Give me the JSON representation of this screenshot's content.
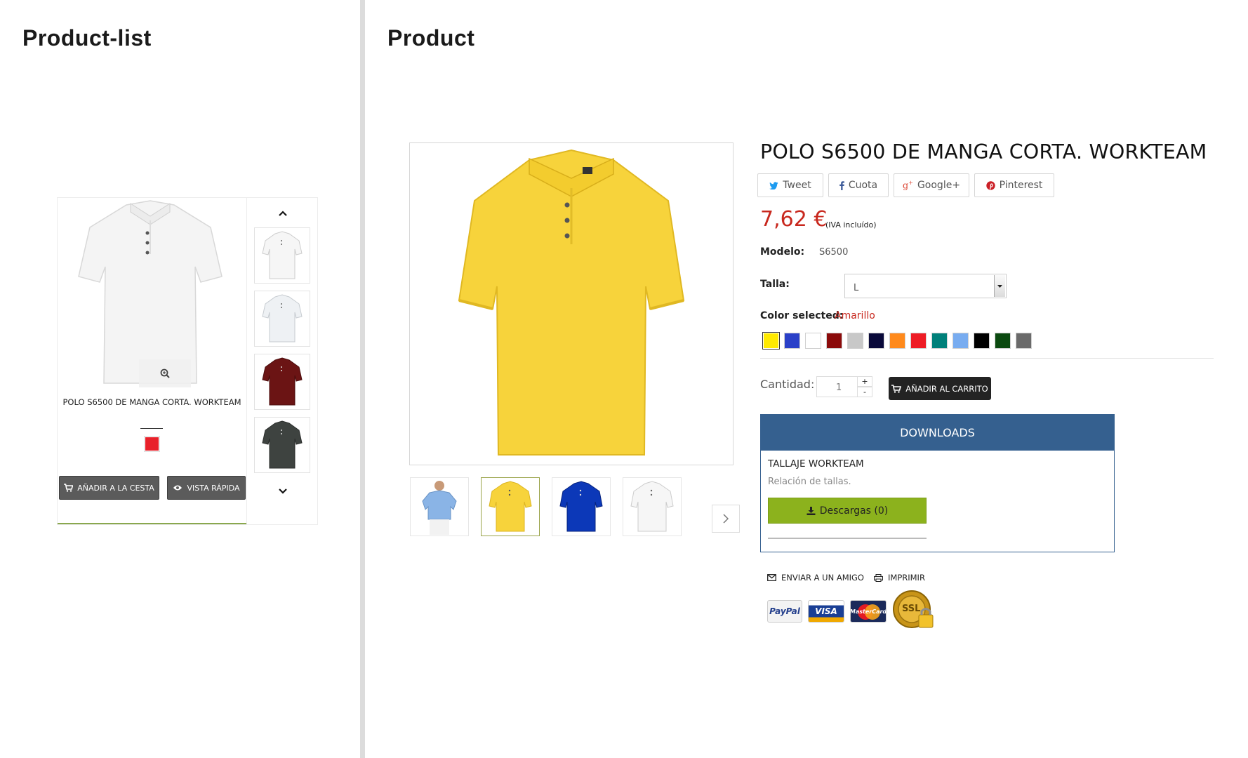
{
  "left_section": {
    "title": "Product-list"
  },
  "right_section": {
    "title": "Product"
  },
  "product_list": {
    "card": {
      "name": "POLO S6500 DE MANGA CORTA. WORKTEAM",
      "swatch_color": "#e8212a",
      "add_to_basket_label": "AÑADIR A LA CESTA",
      "quick_view_label": "VISTA RÁPIDA",
      "thumbnails": [
        "white-polo",
        "white-polo-back",
        "maroon-polo",
        "dark-grey-polo"
      ],
      "icons": [
        "zoom-icon",
        "chevron-up-icon",
        "chevron-down-icon",
        "cart-icon",
        "eye-icon"
      ]
    }
  },
  "product": {
    "title": "POLO S6500 DE MANGA CORTA. WORKTEAM",
    "share_buttons": [
      {
        "label": "Tweet",
        "icon": "twitter-icon"
      },
      {
        "label": "Cuota",
        "icon": "facebook-icon"
      },
      {
        "label": "Google+",
        "icon": "google-plus-icon"
      },
      {
        "label": "Pinterest",
        "icon": "pinterest-icon"
      }
    ],
    "price": "7,62 €",
    "price_note": "(IVA incluído)",
    "model_label": "Modelo:",
    "model_value": "S6500",
    "size_label": "Talla:",
    "size_value": "L",
    "color_label": "Color selected:",
    "color_value": "Amarillo",
    "colors": [
      "#ffea00",
      "#2a40c8",
      "#ffffff",
      "#8b0a0a",
      "#c8c8c8",
      "#0a0a3a",
      "#ff8a1c",
      "#ee1c25",
      "#00807a",
      "#78acf0",
      "#000000",
      "#0b4a10",
      "#6a6a6a"
    ],
    "selected_color_index": 0,
    "quantity_label": "Cantidad:",
    "quantity_value": "1",
    "quantity_plus": "+",
    "quantity_minus": "-",
    "add_to_cart_label": "AÑADIR AL CARRITO",
    "thumbnails": [
      "light-blue-polo-model",
      "yellow-polo",
      "royal-blue-polo",
      "white-polo"
    ],
    "active_thumbnail_index": 1,
    "downloads": {
      "header": "DOWNLOADS",
      "item_name": "TALLAJE WORKTEAM",
      "item_desc": "Relación de tallas.",
      "button_label": "Descargas (0)"
    },
    "send_friend_label": "ENVIAR A UN AMIGO",
    "print_label": "IMPRIMIR",
    "payment_logos": [
      "PayPal",
      "VISA",
      "MasterCard",
      "SSL"
    ]
  }
}
